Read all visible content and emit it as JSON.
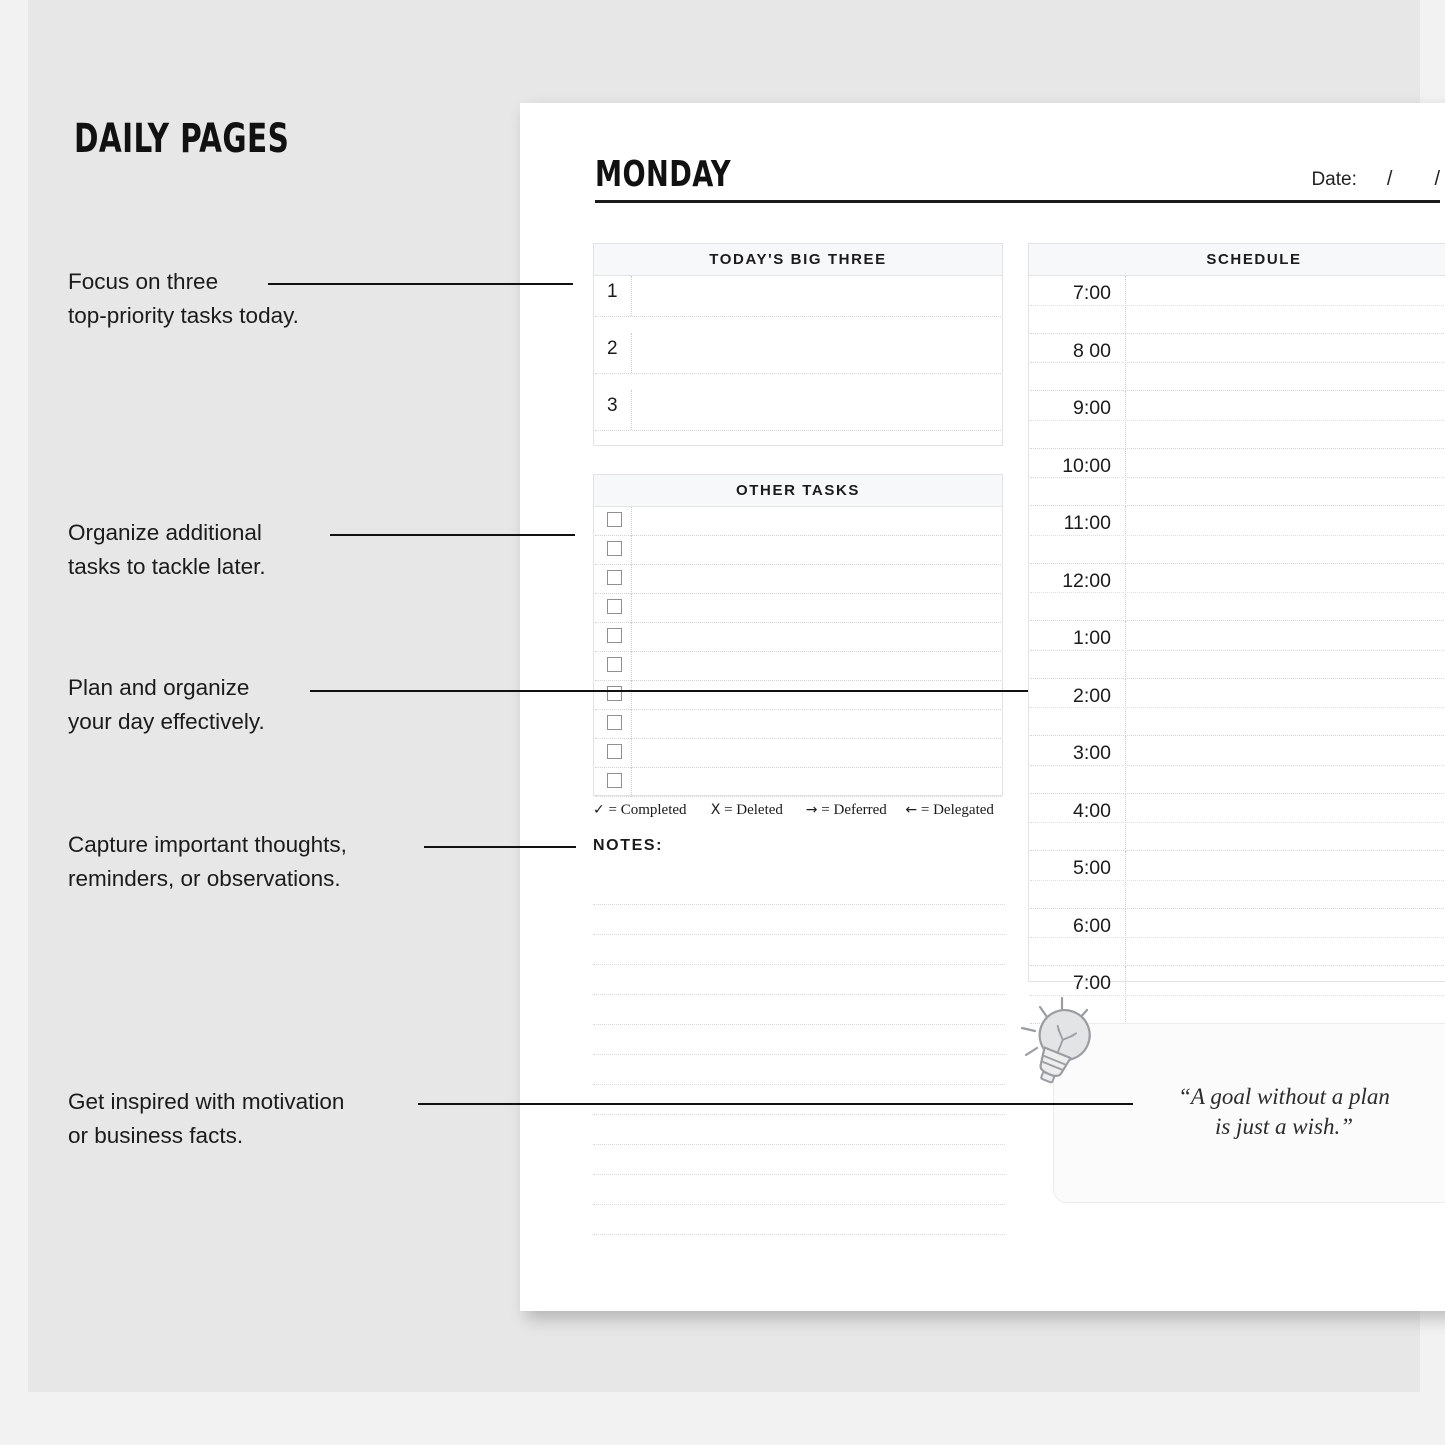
{
  "page_title": "DAILY PAGES",
  "annotations": [
    {
      "line1": "Focus on three",
      "line2": "top-priority tasks today."
    },
    {
      "line1": "Organize additional",
      "line2": "tasks to tackle later."
    },
    {
      "line1": "Plan and organize",
      "line2": "your day effectively."
    },
    {
      "line1": "Capture important thoughts,",
      "line2": "reminders, or observations."
    },
    {
      "line1": "Get inspired with motivation",
      "line2": "or business facts."
    }
  ],
  "planner": {
    "day": "MONDAY",
    "date_label": "Date:",
    "date_slash_1": "/",
    "date_slash_2": "/",
    "big_three": {
      "title": "TODAY'S BIG THREE",
      "numbers": [
        "1",
        "2",
        "3"
      ]
    },
    "other_tasks": {
      "title": "OTHER TASKS",
      "row_count": 10
    },
    "legend": [
      {
        "symbol": "✓",
        "text": "= Completed"
      },
      {
        "symbol": "X",
        "text": "= Deleted"
      },
      {
        "symbol": "→",
        "text": "= Deferred"
      },
      {
        "symbol": "←",
        "text": "= Delegated"
      }
    ],
    "notes": {
      "title": "NOTES:",
      "line_count": 12
    },
    "schedule": {
      "title": "SCHEDULE",
      "times": [
        "7:00",
        "8 00",
        "9:00",
        "10:00",
        "11:00",
        "12:00",
        "1:00",
        "2:00",
        "3:00",
        "4:00",
        "5:00",
        "6:00",
        "7:00"
      ]
    },
    "quote": {
      "line1": "“A goal without a plan",
      "line2": "is just a wish.”"
    }
  },
  "colors": {
    "canvas": "#f2f2f2",
    "panel": "#e7e7e7",
    "page": "#ffffff",
    "ink": "#1b1b1b",
    "header_band": "#f7f8fa",
    "rule": "#e2e3e6",
    "dotted": "#d3d5d9",
    "bulb": "#e3e4e6"
  }
}
